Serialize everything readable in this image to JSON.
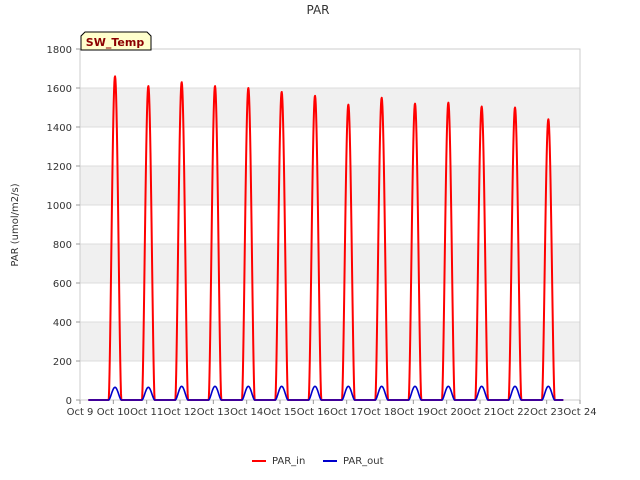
{
  "chart_data": {
    "type": "line",
    "title": "PAR",
    "ylabel": "PAR (umol/m2/s)",
    "xlabel": "",
    "badge": "SW_Temp",
    "ylim": [
      0,
      1800
    ],
    "yticks": [
      0,
      200,
      400,
      600,
      800,
      1000,
      1200,
      1400,
      1600,
      1800
    ],
    "xlim": [
      9,
      24
    ],
    "xticks": [
      {
        "x": 9,
        "label": "Oct 9"
      },
      {
        "x": 10,
        "label": "Oct 10"
      },
      {
        "x": 11,
        "label": "Oct 11"
      },
      {
        "x": 12,
        "label": "Oct 12"
      },
      {
        "x": 13,
        "label": "Oct 13"
      },
      {
        "x": 14,
        "label": "Oct 14"
      },
      {
        "x": 15,
        "label": "Oct 15"
      },
      {
        "x": 16,
        "label": "Oct 16"
      },
      {
        "x": 17,
        "label": "Oct 17"
      },
      {
        "x": 18,
        "label": "Oct 18"
      },
      {
        "x": 19,
        "label": "Oct 19"
      },
      {
        "x": 20,
        "label": "Oct 20"
      },
      {
        "x": 21,
        "label": "Oct 21"
      },
      {
        "x": 22,
        "label": "Oct 22"
      },
      {
        "x": 23,
        "label": "Oct 23"
      },
      {
        "x": 24,
        "label": "Oct 24"
      }
    ],
    "grid": "horizontal bands",
    "legend": "bottom-center",
    "series": [
      {
        "name": "PAR_in",
        "color": "#ff0000",
        "days": [
          10,
          11,
          12,
          13,
          14,
          15,
          16,
          17,
          18,
          19,
          20,
          21,
          22,
          23
        ],
        "peaks": [
          1660,
          1610,
          1630,
          1610,
          1600,
          1580,
          1560,
          1515,
          1550,
          1520,
          1525,
          1505,
          1500,
          1440
        ],
        "start": 9.25,
        "end": 23.5
      },
      {
        "name": "PAR_out",
        "color": "#0000cc",
        "days": [
          10,
          11,
          12,
          13,
          14,
          15,
          16,
          17,
          18,
          19,
          20,
          21,
          22,
          23
        ],
        "peaks": [
          65,
          65,
          70,
          70,
          70,
          70,
          70,
          70,
          70,
          70,
          70,
          70,
          70,
          70
        ],
        "start": 9.25,
        "end": 23.5
      }
    ]
  },
  "colors": {
    "band": "#f0f0f0",
    "gridline": "#dddddd",
    "axis": "#cccccc",
    "badge_fill": "#ffffcc",
    "badge_text": "#8b0000"
  }
}
